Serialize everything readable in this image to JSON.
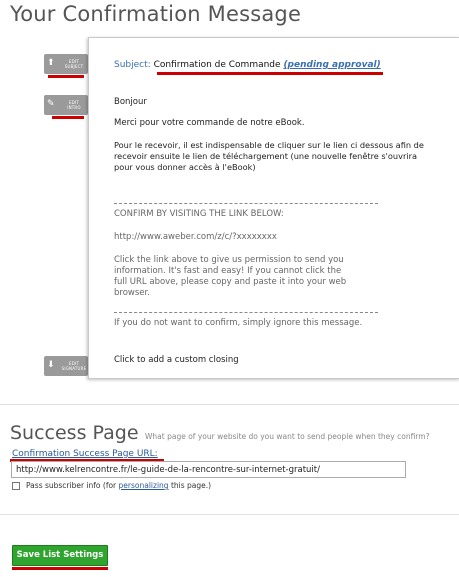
{
  "confirmation": {
    "title": "Your Confirmation Message",
    "edit_subject": {
      "line1": "EDIT",
      "line2": "SUBJECT"
    },
    "edit_intro": {
      "line1": "EDIT",
      "line2": "INTRO"
    },
    "edit_signature": {
      "line1": "EDIT",
      "line2": "SIGNATURE"
    },
    "subject_label": "Subject:",
    "subject_value": "Confirmation de Commande",
    "subject_status": "(pending approval)",
    "greeting": "Bonjour",
    "intro_line1": "Merci pour votre commande de notre eBook.",
    "intro_para2_line1": "Pour le recevoir, il est indispensable de cliquer sur le lien ci dessous afin de",
    "intro_para2_line2": "recevoir ensuite le lien de téléchargement (une nouvelle fenêtre s'ouvrira",
    "intro_para2_line3": "pour vous donner accès à l'eBook)",
    "confirm_heading": "CONFIRM BY VISITING THE LINK BELOW:",
    "confirm_link": "http://www.aweber.com/z/c/?xxxxxxxx",
    "perm_line1": "Click the link above to give us permission to send you",
    "perm_line2": "information. It's fast and easy! If you cannot click the",
    "perm_line3": "full URL above, please copy and paste it into your web",
    "perm_line4": "browser.",
    "ignore_text": "If you do not want to confirm, simply ignore this message.",
    "closing_text": "Click to add a custom closing"
  },
  "success": {
    "title": "Success Page",
    "subtitle": "What page of your website do you want to send people when they confirm?",
    "url_label": "Confirmation Success Page URL:",
    "url_value": "http://www.kelrencontre.fr/le-guide-de-la-rencontre-sur-internet-gratuit/",
    "pass_info_text": "Pass subscriber info (for",
    "pass_info_link": "personalizing",
    "pass_info_end": "this page.)"
  },
  "actions": {
    "save_label": "Save List Settings"
  },
  "colors": {
    "highlight": "#cc0000",
    "save_button": "#2fa52f",
    "link": "#2a5a9a"
  }
}
